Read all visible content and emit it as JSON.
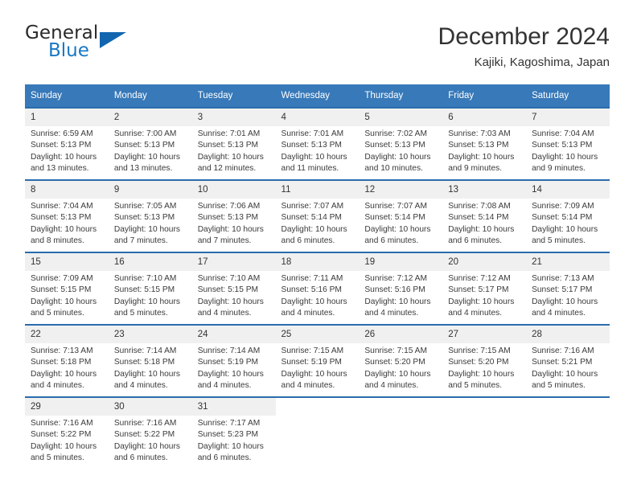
{
  "logo": {
    "word_top": "General",
    "word_bottom": "Blue",
    "accent_color": "#1878c4",
    "triangle_color": "#1266b0",
    "triangle_icon": "triangle-icon"
  },
  "header": {
    "title": "December 2024",
    "subtitle": "Kajiki, Kagoshima, Japan"
  },
  "calendar": {
    "header_bg": "#3779b9",
    "row_rule_color": "#2a6cad",
    "daynum_bg": "#f0f0f0",
    "weekdays": [
      "Sunday",
      "Monday",
      "Tuesday",
      "Wednesday",
      "Thursday",
      "Friday",
      "Saturday"
    ],
    "weeks": [
      [
        {
          "day": "1",
          "sunrise": "Sunrise: 6:59 AM",
          "sunset": "Sunset: 5:13 PM",
          "daylight1": "Daylight: 10 hours",
          "daylight2": "and 13 minutes."
        },
        {
          "day": "2",
          "sunrise": "Sunrise: 7:00 AM",
          "sunset": "Sunset: 5:13 PM",
          "daylight1": "Daylight: 10 hours",
          "daylight2": "and 13 minutes."
        },
        {
          "day": "3",
          "sunrise": "Sunrise: 7:01 AM",
          "sunset": "Sunset: 5:13 PM",
          "daylight1": "Daylight: 10 hours",
          "daylight2": "and 12 minutes."
        },
        {
          "day": "4",
          "sunrise": "Sunrise: 7:01 AM",
          "sunset": "Sunset: 5:13 PM",
          "daylight1": "Daylight: 10 hours",
          "daylight2": "and 11 minutes."
        },
        {
          "day": "5",
          "sunrise": "Sunrise: 7:02 AM",
          "sunset": "Sunset: 5:13 PM",
          "daylight1": "Daylight: 10 hours",
          "daylight2": "and 10 minutes."
        },
        {
          "day": "6",
          "sunrise": "Sunrise: 7:03 AM",
          "sunset": "Sunset: 5:13 PM",
          "daylight1": "Daylight: 10 hours",
          "daylight2": "and 9 minutes."
        },
        {
          "day": "7",
          "sunrise": "Sunrise: 7:04 AM",
          "sunset": "Sunset: 5:13 PM",
          "daylight1": "Daylight: 10 hours",
          "daylight2": "and 9 minutes."
        }
      ],
      [
        {
          "day": "8",
          "sunrise": "Sunrise: 7:04 AM",
          "sunset": "Sunset: 5:13 PM",
          "daylight1": "Daylight: 10 hours",
          "daylight2": "and 8 minutes."
        },
        {
          "day": "9",
          "sunrise": "Sunrise: 7:05 AM",
          "sunset": "Sunset: 5:13 PM",
          "daylight1": "Daylight: 10 hours",
          "daylight2": "and 7 minutes."
        },
        {
          "day": "10",
          "sunrise": "Sunrise: 7:06 AM",
          "sunset": "Sunset: 5:13 PM",
          "daylight1": "Daylight: 10 hours",
          "daylight2": "and 7 minutes."
        },
        {
          "day": "11",
          "sunrise": "Sunrise: 7:07 AM",
          "sunset": "Sunset: 5:14 PM",
          "daylight1": "Daylight: 10 hours",
          "daylight2": "and 6 minutes."
        },
        {
          "day": "12",
          "sunrise": "Sunrise: 7:07 AM",
          "sunset": "Sunset: 5:14 PM",
          "daylight1": "Daylight: 10 hours",
          "daylight2": "and 6 minutes."
        },
        {
          "day": "13",
          "sunrise": "Sunrise: 7:08 AM",
          "sunset": "Sunset: 5:14 PM",
          "daylight1": "Daylight: 10 hours",
          "daylight2": "and 6 minutes."
        },
        {
          "day": "14",
          "sunrise": "Sunrise: 7:09 AM",
          "sunset": "Sunset: 5:14 PM",
          "daylight1": "Daylight: 10 hours",
          "daylight2": "and 5 minutes."
        }
      ],
      [
        {
          "day": "15",
          "sunrise": "Sunrise: 7:09 AM",
          "sunset": "Sunset: 5:15 PM",
          "daylight1": "Daylight: 10 hours",
          "daylight2": "and 5 minutes."
        },
        {
          "day": "16",
          "sunrise": "Sunrise: 7:10 AM",
          "sunset": "Sunset: 5:15 PM",
          "daylight1": "Daylight: 10 hours",
          "daylight2": "and 5 minutes."
        },
        {
          "day": "17",
          "sunrise": "Sunrise: 7:10 AM",
          "sunset": "Sunset: 5:15 PM",
          "daylight1": "Daylight: 10 hours",
          "daylight2": "and 4 minutes."
        },
        {
          "day": "18",
          "sunrise": "Sunrise: 7:11 AM",
          "sunset": "Sunset: 5:16 PM",
          "daylight1": "Daylight: 10 hours",
          "daylight2": "and 4 minutes."
        },
        {
          "day": "19",
          "sunrise": "Sunrise: 7:12 AM",
          "sunset": "Sunset: 5:16 PM",
          "daylight1": "Daylight: 10 hours",
          "daylight2": "and 4 minutes."
        },
        {
          "day": "20",
          "sunrise": "Sunrise: 7:12 AM",
          "sunset": "Sunset: 5:17 PM",
          "daylight1": "Daylight: 10 hours",
          "daylight2": "and 4 minutes."
        },
        {
          "day": "21",
          "sunrise": "Sunrise: 7:13 AM",
          "sunset": "Sunset: 5:17 PM",
          "daylight1": "Daylight: 10 hours",
          "daylight2": "and 4 minutes."
        }
      ],
      [
        {
          "day": "22",
          "sunrise": "Sunrise: 7:13 AM",
          "sunset": "Sunset: 5:18 PM",
          "daylight1": "Daylight: 10 hours",
          "daylight2": "and 4 minutes."
        },
        {
          "day": "23",
          "sunrise": "Sunrise: 7:14 AM",
          "sunset": "Sunset: 5:18 PM",
          "daylight1": "Daylight: 10 hours",
          "daylight2": "and 4 minutes."
        },
        {
          "day": "24",
          "sunrise": "Sunrise: 7:14 AM",
          "sunset": "Sunset: 5:19 PM",
          "daylight1": "Daylight: 10 hours",
          "daylight2": "and 4 minutes."
        },
        {
          "day": "25",
          "sunrise": "Sunrise: 7:15 AM",
          "sunset": "Sunset: 5:19 PM",
          "daylight1": "Daylight: 10 hours",
          "daylight2": "and 4 minutes."
        },
        {
          "day": "26",
          "sunrise": "Sunrise: 7:15 AM",
          "sunset": "Sunset: 5:20 PM",
          "daylight1": "Daylight: 10 hours",
          "daylight2": "and 4 minutes."
        },
        {
          "day": "27",
          "sunrise": "Sunrise: 7:15 AM",
          "sunset": "Sunset: 5:20 PM",
          "daylight1": "Daylight: 10 hours",
          "daylight2": "and 5 minutes."
        },
        {
          "day": "28",
          "sunrise": "Sunrise: 7:16 AM",
          "sunset": "Sunset: 5:21 PM",
          "daylight1": "Daylight: 10 hours",
          "daylight2": "and 5 minutes."
        }
      ],
      [
        {
          "day": "29",
          "sunrise": "Sunrise: 7:16 AM",
          "sunset": "Sunset: 5:22 PM",
          "daylight1": "Daylight: 10 hours",
          "daylight2": "and 5 minutes."
        },
        {
          "day": "30",
          "sunrise": "Sunrise: 7:16 AM",
          "sunset": "Sunset: 5:22 PM",
          "daylight1": "Daylight: 10 hours",
          "daylight2": "and 6 minutes."
        },
        {
          "day": "31",
          "sunrise": "Sunrise: 7:17 AM",
          "sunset": "Sunset: 5:23 PM",
          "daylight1": "Daylight: 10 hours",
          "daylight2": "and 6 minutes."
        },
        {
          "day": "",
          "sunrise": "",
          "sunset": "",
          "daylight1": "",
          "daylight2": ""
        },
        {
          "day": "",
          "sunrise": "",
          "sunset": "",
          "daylight1": "",
          "daylight2": ""
        },
        {
          "day": "",
          "sunrise": "",
          "sunset": "",
          "daylight1": "",
          "daylight2": ""
        },
        {
          "day": "",
          "sunrise": "",
          "sunset": "",
          "daylight1": "",
          "daylight2": ""
        }
      ]
    ]
  }
}
